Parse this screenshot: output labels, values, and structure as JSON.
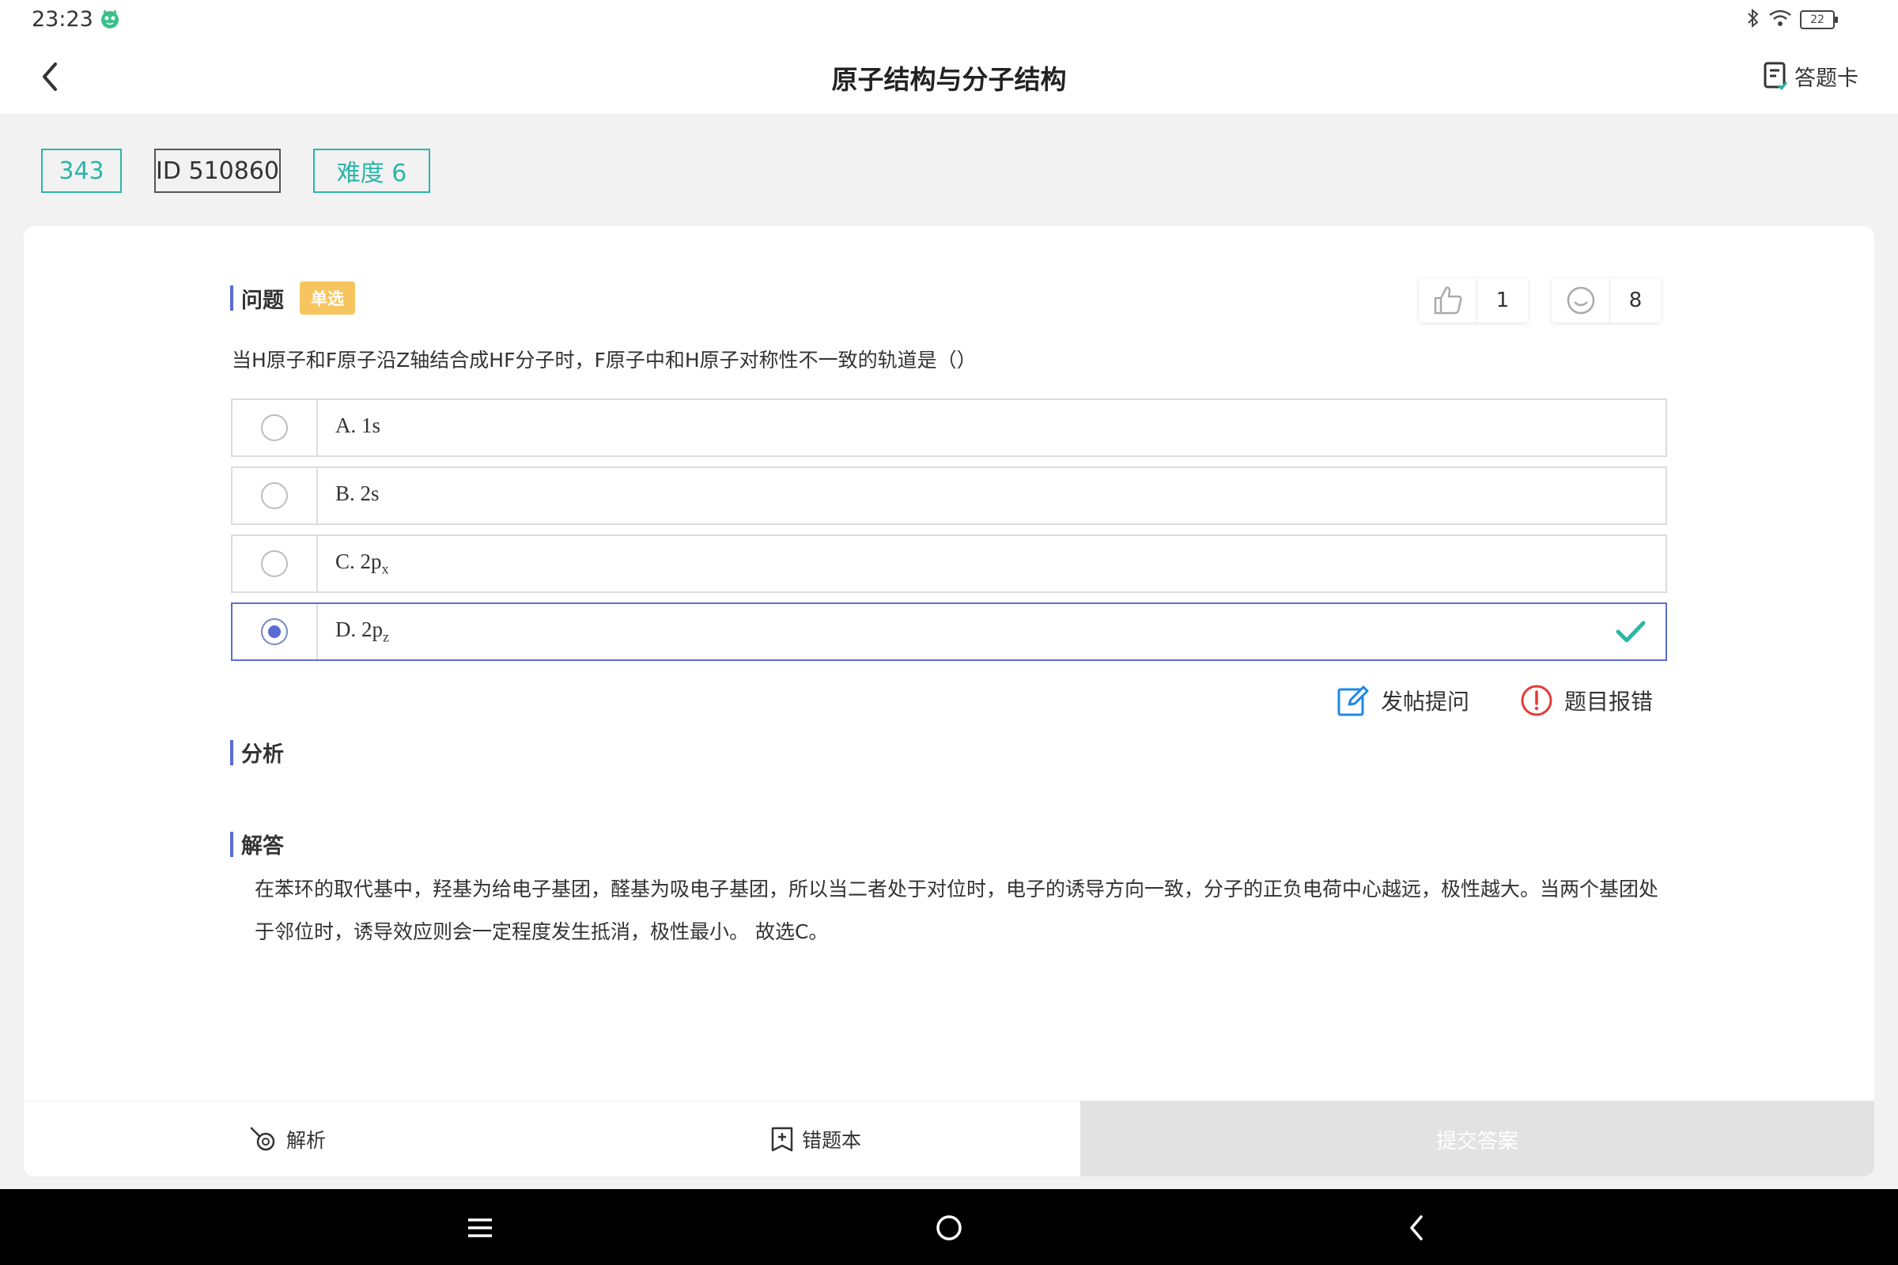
{
  "status_bar": {
    "time": "23:23",
    "battery": "22"
  },
  "header": {
    "title": "原子结构与分子结构",
    "answer_card_label": "答题卡"
  },
  "tags": {
    "number": "343",
    "id": "ID 510860",
    "difficulty": "难度 6"
  },
  "question": {
    "section_title": "问题",
    "type_badge": "单选",
    "like_count": "1",
    "comment_count": "8",
    "text": "当H原子和F原子沿Z轴结合成HF分子时，F原子中和H原子对称性不一致的轨道是（）",
    "options": [
      {
        "label": "A. 1s",
        "sub": "",
        "selected": false
      },
      {
        "label": "B. 2s",
        "sub": "",
        "selected": false
      },
      {
        "label": "C. 2p",
        "sub": "x",
        "selected": false
      },
      {
        "label": "D. 2p",
        "sub": "z",
        "selected": true
      }
    ]
  },
  "actions": {
    "post_question": "发帖提问",
    "report_error": "题目报错"
  },
  "analysis": {
    "section_title": "分析"
  },
  "answer": {
    "section_title": "解答",
    "text": "在苯环的取代基中，羟基为给电子基团，醛基为吸电子基团，所以当二者处于对位时，电子的诱导方向一致，分子的正负电荷中心越远，极性越大。当两个基团处于邻位时，诱导效应则会一定程度发生抵消，极性最小。 故选C。"
  },
  "bottom_bar": {
    "analysis_label": "解析",
    "wrongbook_label": "错题本",
    "submit_label": "提交答案"
  },
  "colors": {
    "accent": "#5b6bd6",
    "teal": "#2bb5a8",
    "badge": "#f7c55f",
    "check": "#2bb5a8",
    "report": "#e53935",
    "edit": "#1e88e5"
  },
  "icons": {
    "back": "back-arrow-icon",
    "answer_card": "answer-card-icon",
    "like": "thumbs-up-icon",
    "comment": "smiley-icon",
    "check": "checkmark-icon",
    "post": "edit-icon",
    "report": "exclamation-circle-icon",
    "analysis": "magnifier-icon",
    "wrongbook": "bookmark-plus-icon"
  }
}
